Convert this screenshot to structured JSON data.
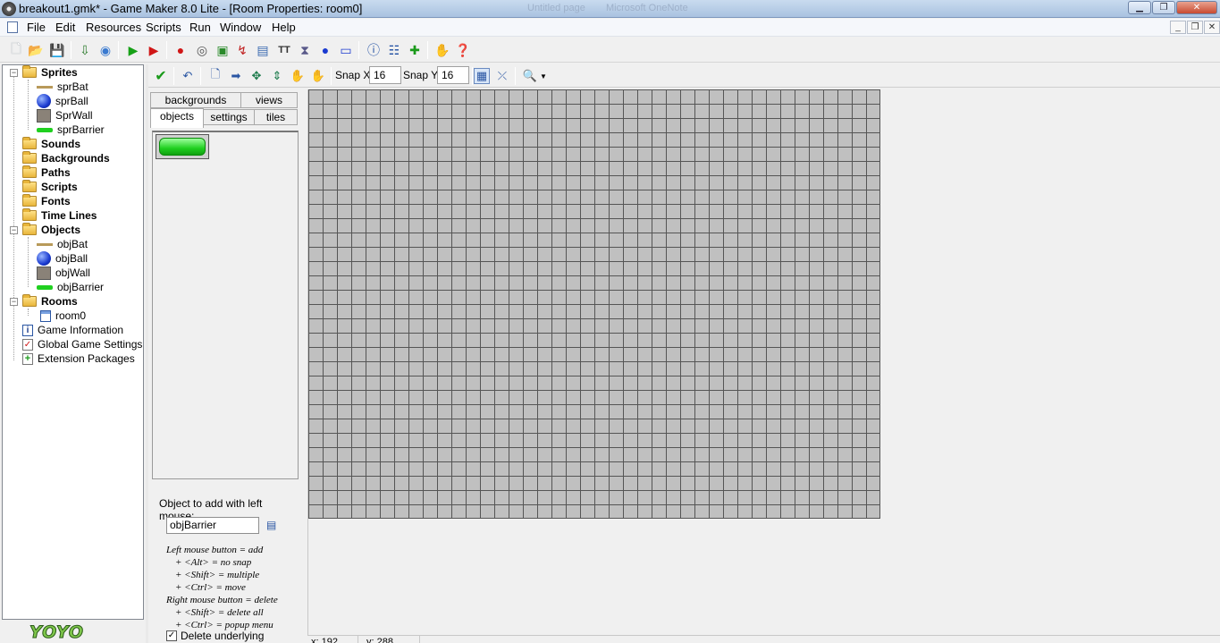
{
  "window": {
    "title": "breakout1.gmk* - Game Maker 8.0 Lite - [Room Properties: room0]",
    "ghost_title_1": "Untitled page",
    "ghost_title_2": "Microsoft OneNote"
  },
  "menu": [
    "File",
    "Edit",
    "Resources",
    "Scripts",
    "Run",
    "Window",
    "Help"
  ],
  "tree": {
    "sprites": {
      "label": "Sprites",
      "items": [
        "sprBat",
        "sprBall",
        "SprWall",
        "sprBarrier"
      ]
    },
    "sounds": "Sounds",
    "backgrounds": "Backgrounds",
    "paths": "Paths",
    "scripts": "Scripts",
    "fonts": "Fonts",
    "timelines": "Time Lines",
    "objects": {
      "label": "Objects",
      "items": [
        "objBat",
        "objBall",
        "objWall",
        "objBarrier"
      ]
    },
    "rooms": {
      "label": "Rooms",
      "items": [
        "room0"
      ]
    },
    "game_info": "Game Information",
    "global_settings": "Global Game Settings",
    "extensions": "Extension Packages"
  },
  "logo": "YOYO",
  "room_toolbar": {
    "snap_x_label": "Snap X:",
    "snap_x": "16",
    "snap_y_label": "Snap Y:",
    "snap_y": "16"
  },
  "tabs": {
    "backgrounds": "backgrounds",
    "views": "views",
    "objects": "objects",
    "settings": "settings",
    "tiles": "tiles"
  },
  "object_panel": {
    "label": "Object to add with left mouse:",
    "value": "objBarrier",
    "help": [
      "Left mouse button = add",
      "+ <Alt> = no snap",
      "+ <Shift> = multiple",
      "+ <Ctrl> = move",
      "Right mouse button = delete",
      "+ <Shift> = delete all",
      "+ <Ctrl> = popup menu"
    ],
    "delete_underlying": "Delete underlying"
  },
  "status": {
    "x": "x: 192",
    "y": "y: 288"
  }
}
